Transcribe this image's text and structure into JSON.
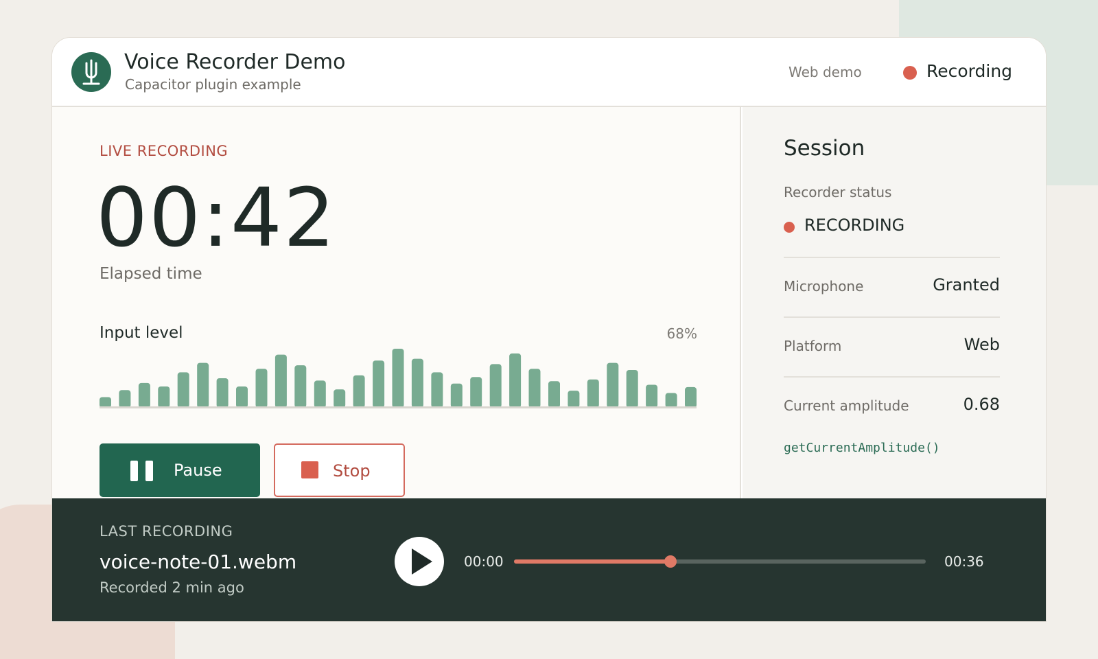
{
  "header": {
    "title": "Voice Recorder Demo",
    "subtitle": "Capacitor plugin example",
    "web_demo": "Web demo",
    "status": "Recording",
    "logo_icon": "microphone-icon"
  },
  "recorder": {
    "section_label": "LIVE RECORDING",
    "elapsed": "00:42",
    "elapsed_label": "Elapsed time",
    "input_level_label": "Input level",
    "input_level_pct": "68%",
    "input_level_value": 0.68,
    "level_bars": [
      0.18,
      0.3,
      0.42,
      0.36,
      0.6,
      0.76,
      0.5,
      0.36,
      0.66,
      0.9,
      0.72,
      0.46,
      0.31,
      0.55,
      0.8,
      1.0,
      0.83,
      0.6,
      0.41,
      0.52,
      0.74,
      0.92,
      0.66,
      0.45,
      0.29,
      0.48,
      0.76,
      0.64,
      0.39,
      0.25,
      0.35
    ],
    "pause_label": "Pause",
    "stop_label": "Stop"
  },
  "session": {
    "title": "Session",
    "status_label": "Recorder status",
    "status_value": "RECORDING",
    "rows": [
      {
        "key": "Microphone",
        "value": "Granted"
      },
      {
        "key": "Platform",
        "value": "Web"
      },
      {
        "key": "Current amplitude",
        "value": "0.68"
      }
    ],
    "api_call": "getCurrentAmplitude()"
  },
  "player": {
    "section_label": "LAST RECORDING",
    "file_name": "voice-note-01.webm",
    "recorded": "Recorded 2 min ago",
    "current_time": "00:00",
    "total_time": "00:36",
    "progress": 0.38
  },
  "colors": {
    "accent_green": "#226650",
    "bar_green": "#78ab91",
    "recording_red": "#d9604f",
    "player_bg": "#263530"
  }
}
